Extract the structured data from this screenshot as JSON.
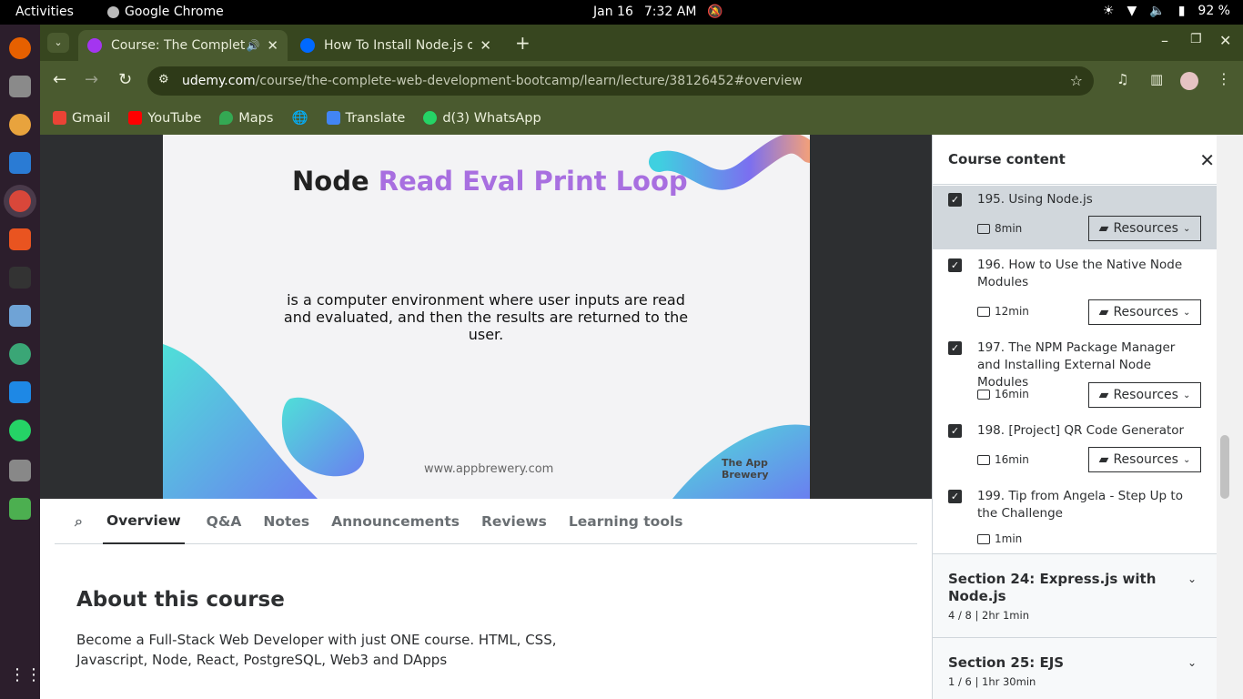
{
  "system": {
    "activities": "Activities",
    "app_name": "Google Chrome",
    "date": "Jan 16",
    "time": "7:32 AM",
    "battery": "92 %"
  },
  "browser": {
    "tabs": [
      {
        "title": "Course: The Complete",
        "active": true
      },
      {
        "title": "How To Install Node.js o",
        "active": false
      }
    ],
    "url_host": "udemy.com",
    "url_path": "/course/the-complete-web-development-bootcamp/learn/lecture/38126452#overview",
    "bookmarks": [
      "Gmail",
      "YouTube",
      "Maps",
      "Translate",
      "d(3) WhatsApp"
    ]
  },
  "slide": {
    "title_word": "Node",
    "title_accent": "Read Eval Print Loop",
    "description": "is a computer environment where user inputs are read and evaluated, and then the results are returned to the user.",
    "website": "www.appbrewery.com",
    "brand": "The App Brewery"
  },
  "course_tabs": [
    "Overview",
    "Q&A",
    "Notes",
    "Announcements",
    "Reviews",
    "Learning tools"
  ],
  "about": {
    "heading": "About this course",
    "text": "Become a Full-Stack Web Developer with just ONE course. HTML, CSS, Javascript, Node, React, PostgreSQL, Web3 and DApps"
  },
  "sidebar": {
    "title": "Course content",
    "lectures": [
      {
        "title": "195. Using Node.js",
        "duration": "8min",
        "resources": "Resources"
      },
      {
        "title": "196. How to Use the Native Node Modules",
        "duration": "12min",
        "resources": "Resources"
      },
      {
        "title": "197. The NPM Package Manager and Installing External Node Modules",
        "duration": "16min",
        "resources": "Resources"
      },
      {
        "title": "198. [Project] QR Code Generator",
        "duration": "16min",
        "resources": "Resources"
      },
      {
        "title": "199. Tip from Angela - Step Up to the Challenge",
        "duration": "1min"
      }
    ],
    "sections": [
      {
        "title": "Section 24: Express.js with Node.js",
        "meta": "4 / 8 | 2hr 1min"
      },
      {
        "title": "Section 25: EJS",
        "meta": "1 / 6 | 1hr 30min"
      }
    ]
  }
}
